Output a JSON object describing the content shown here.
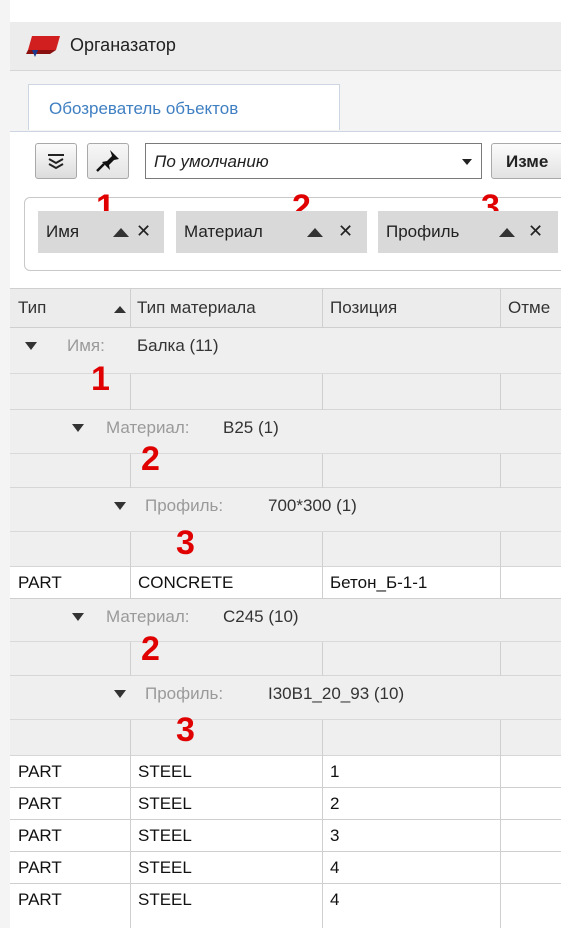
{
  "window": {
    "title": "Органазатор"
  },
  "tabs": [
    {
      "label": "Обозреватель объектов"
    }
  ],
  "toolbar": {
    "collapse_icon": "double-chevron-down-icon",
    "pin_icon": "pin-icon",
    "view_combo_value": "По умолчанию",
    "change_button_label": "Изме"
  },
  "grouping": {
    "chips": [
      {
        "label": "Имя",
        "marker": "1"
      },
      {
        "label": "Материал",
        "marker": "2"
      },
      {
        "label": "Профиль",
        "marker": "3"
      }
    ]
  },
  "table": {
    "columns": [
      "Тип",
      "Тип материала",
      "Позиция",
      "Отме"
    ],
    "groups": [
      {
        "key": "Имя:",
        "value": "Балка (11)",
        "marker": "1"
      },
      {
        "key": "Материал:",
        "value": "B25 (1)",
        "marker": "2"
      },
      {
        "key": "Профиль:",
        "value": "700*300 (1)",
        "marker": "3"
      },
      {
        "key": "Материал:",
        "value": "C245 (10)",
        "marker": "2"
      },
      {
        "key": "Профиль:",
        "value": "I30B1_20_93 (10)",
        "marker": "3"
      }
    ],
    "rows": [
      [
        "PART",
        "CONCRETE",
        "Бетон_Б-1-1"
      ],
      [
        "PART",
        "STEEL",
        "1"
      ],
      [
        "PART",
        "STEEL",
        "2"
      ],
      [
        "PART",
        "STEEL",
        "3"
      ],
      [
        "PART",
        "STEEL",
        "4"
      ],
      [
        "PART",
        "STEEL",
        "4"
      ]
    ]
  },
  "colors": {
    "accent": "#3f7fc2",
    "marker": "#e00000",
    "group_bg": "#efefef"
  }
}
